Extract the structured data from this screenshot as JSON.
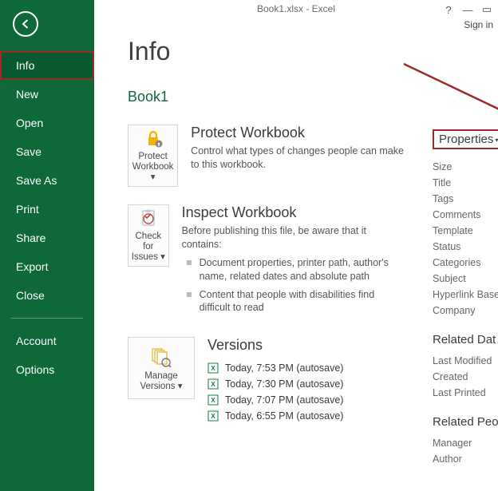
{
  "titlebar": {
    "text": "Book1.xlsx - Excel",
    "signin": "Sign in"
  },
  "sidebar": {
    "items": [
      {
        "label": "Info"
      },
      {
        "label": "New"
      },
      {
        "label": "Open"
      },
      {
        "label": "Save"
      },
      {
        "label": "Save As"
      },
      {
        "label": "Print"
      },
      {
        "label": "Share"
      },
      {
        "label": "Export"
      },
      {
        "label": "Close"
      },
      {
        "label": "Account"
      },
      {
        "label": "Options"
      }
    ]
  },
  "page": {
    "title": "Info",
    "filename": "Book1"
  },
  "protect": {
    "tile": "Protect Workbook ▾",
    "heading": "Protect Workbook",
    "desc": "Control what types of changes people can make to this workbook."
  },
  "inspect": {
    "tile": "Check for Issues ▾",
    "heading": "Inspect Workbook",
    "desc": "Before publishing this file, be aware that it contains:",
    "bullet1": "Document properties, printer path, author's name, related dates and absolute path",
    "bullet2": "Content that people with disabilities find difficult to read"
  },
  "versions": {
    "tile": "Manage Versions ▾",
    "heading": "Versions",
    "items": [
      "Today, 7:53 PM (autosave)",
      "Today, 7:30 PM (autosave)",
      "Today, 7:07 PM (autosave)",
      "Today, 6:55 PM (autosave)"
    ]
  },
  "props": {
    "header": "Properties",
    "rows": [
      "Size",
      "Title",
      "Tags",
      "Comments",
      "Template",
      "Status",
      "Categories",
      "Subject",
      "Hyperlink Base",
      "Company"
    ],
    "related_dates_title": "Related Dat",
    "related_dates": [
      "Last Modified",
      "Created",
      "Last Printed"
    ],
    "related_people_title": "Related Peo",
    "related_people": [
      "Manager",
      "Author"
    ]
  }
}
